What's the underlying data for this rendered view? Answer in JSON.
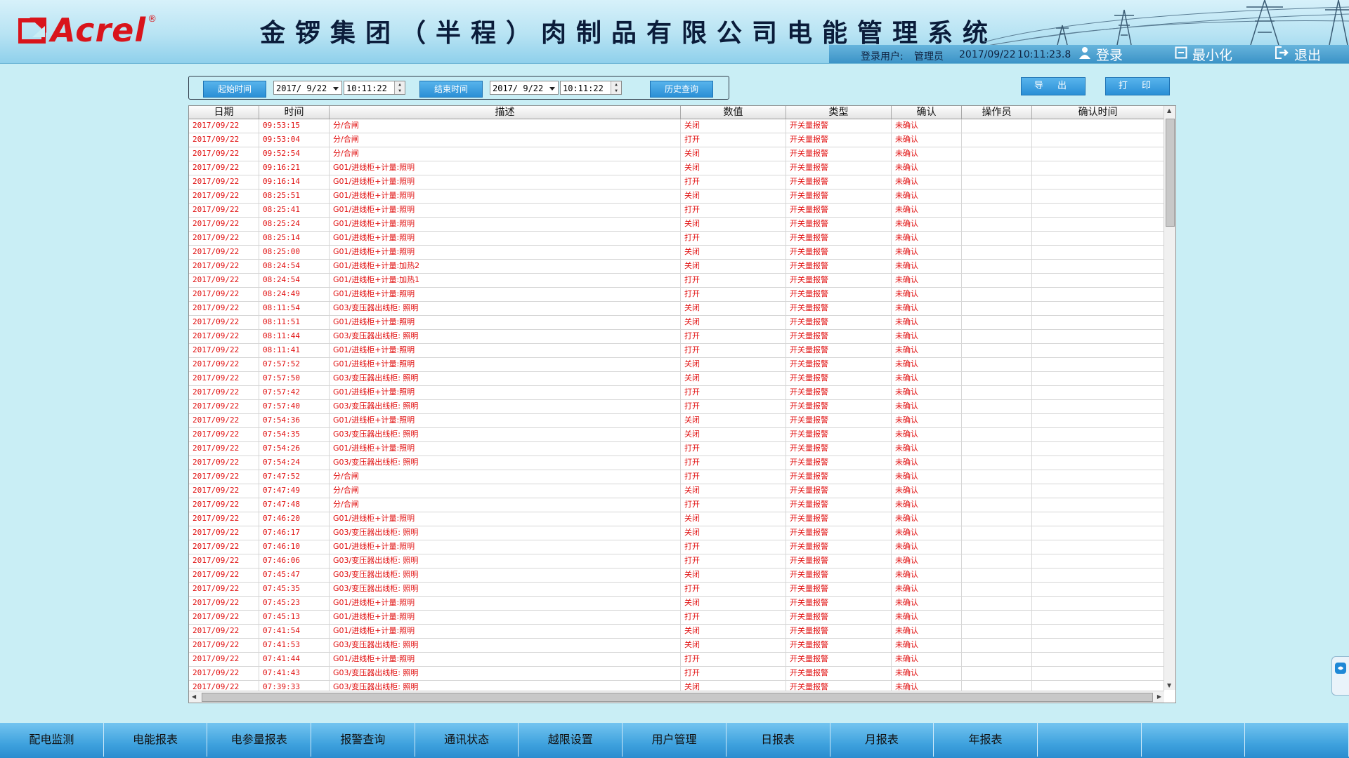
{
  "brand": {
    "name": "Acrel",
    "reg": "®",
    "accent": "#d9141b"
  },
  "title": "金锣集团（半程）肉制品有限公司电能管理系统",
  "header": {
    "user_label": "登录用户:",
    "user_name": "管理员",
    "date": "2017/09/22",
    "time": "10:11:23.8",
    "login": "登录",
    "minimize": "最小化",
    "exit": "退出"
  },
  "query": {
    "start_label": "起始时间",
    "start_date": "2017/ 9/22",
    "start_time": "10:11:22",
    "end_label": "结束时间",
    "end_date": "2017/ 9/22",
    "end_time": "10:11:22",
    "history_label": "历史查询",
    "export_label": "导 出",
    "print_label": "打 印"
  },
  "table": {
    "columns": [
      "日期",
      "时间",
      "描述",
      "数值",
      "类型",
      "确认",
      "操作员",
      "确认时间"
    ],
    "rows": [
      [
        "2017/09/22",
        "09:53:15",
        "分/合闸",
        "关闭",
        "开关量报警",
        "未确认",
        "",
        ""
      ],
      [
        "2017/09/22",
        "09:53:04",
        "分/合闸",
        "打开",
        "开关量报警",
        "未确认",
        "",
        ""
      ],
      [
        "2017/09/22",
        "09:52:54",
        "分/合闸",
        "关闭",
        "开关量报警",
        "未确认",
        "",
        ""
      ],
      [
        "2017/09/22",
        "09:16:21",
        "G01/进线柜+计量:照明",
        "关闭",
        "开关量报警",
        "未确认",
        "",
        ""
      ],
      [
        "2017/09/22",
        "09:16:14",
        "G01/进线柜+计量:照明",
        "打开",
        "开关量报警",
        "未确认",
        "",
        ""
      ],
      [
        "2017/09/22",
        "08:25:51",
        "G01/进线柜+计量:照明",
        "关闭",
        "开关量报警",
        "未确认",
        "",
        ""
      ],
      [
        "2017/09/22",
        "08:25:41",
        "G01/进线柜+计量:照明",
        "打开",
        "开关量报警",
        "未确认",
        "",
        ""
      ],
      [
        "2017/09/22",
        "08:25:24",
        "G01/进线柜+计量:照明",
        "关闭",
        "开关量报警",
        "未确认",
        "",
        ""
      ],
      [
        "2017/09/22",
        "08:25:14",
        "G01/进线柜+计量:照明",
        "打开",
        "开关量报警",
        "未确认",
        "",
        ""
      ],
      [
        "2017/09/22",
        "08:25:00",
        "G01/进线柜+计量:照明",
        "关闭",
        "开关量报警",
        "未确认",
        "",
        ""
      ],
      [
        "2017/09/22",
        "08:24:54",
        "G01/进线柜+计量:加热2",
        "关闭",
        "开关量报警",
        "未确认",
        "",
        ""
      ],
      [
        "2017/09/22",
        "08:24:54",
        "G01/进线柜+计量:加热1",
        "打开",
        "开关量报警",
        "未确认",
        "",
        ""
      ],
      [
        "2017/09/22",
        "08:24:49",
        "G01/进线柜+计量:照明",
        "打开",
        "开关量报警",
        "未确认",
        "",
        ""
      ],
      [
        "2017/09/22",
        "08:11:54",
        "G03/变压器出线柜: 照明",
        "关闭",
        "开关量报警",
        "未确认",
        "",
        ""
      ],
      [
        "2017/09/22",
        "08:11:51",
        "G01/进线柜+计量:照明",
        "关闭",
        "开关量报警",
        "未确认",
        "",
        ""
      ],
      [
        "2017/09/22",
        "08:11:44",
        "G03/变压器出线柜: 照明",
        "打开",
        "开关量报警",
        "未确认",
        "",
        ""
      ],
      [
        "2017/09/22",
        "08:11:41",
        "G01/进线柜+计量:照明",
        "打开",
        "开关量报警",
        "未确认",
        "",
        ""
      ],
      [
        "2017/09/22",
        "07:57:52",
        "G01/进线柜+计量:照明",
        "关闭",
        "开关量报警",
        "未确认",
        "",
        ""
      ],
      [
        "2017/09/22",
        "07:57:50",
        "G03/变压器出线柜: 照明",
        "关闭",
        "开关量报警",
        "未确认",
        "",
        ""
      ],
      [
        "2017/09/22",
        "07:57:42",
        "G01/进线柜+计量:照明",
        "打开",
        "开关量报警",
        "未确认",
        "",
        ""
      ],
      [
        "2017/09/22",
        "07:57:40",
        "G03/变压器出线柜: 照明",
        "打开",
        "开关量报警",
        "未确认",
        "",
        ""
      ],
      [
        "2017/09/22",
        "07:54:36",
        "G01/进线柜+计量:照明",
        "关闭",
        "开关量报警",
        "未确认",
        "",
        ""
      ],
      [
        "2017/09/22",
        "07:54:35",
        "G03/变压器出线柜: 照明",
        "关闭",
        "开关量报警",
        "未确认",
        "",
        ""
      ],
      [
        "2017/09/22",
        "07:54:26",
        "G01/进线柜+计量:照明",
        "打开",
        "开关量报警",
        "未确认",
        "",
        ""
      ],
      [
        "2017/09/22",
        "07:54:24",
        "G03/变压器出线柜: 照明",
        "打开",
        "开关量报警",
        "未确认",
        "",
        ""
      ],
      [
        "2017/09/22",
        "07:47:52",
        "分/合闸",
        "打开",
        "开关量报警",
        "未确认",
        "",
        ""
      ],
      [
        "2017/09/22",
        "07:47:49",
        "分/合闸",
        "关闭",
        "开关量报警",
        "未确认",
        "",
        ""
      ],
      [
        "2017/09/22",
        "07:47:48",
        "分/合闸",
        "打开",
        "开关量报警",
        "未确认",
        "",
        ""
      ],
      [
        "2017/09/22",
        "07:46:20",
        "G01/进线柜+计量:照明",
        "关闭",
        "开关量报警",
        "未确认",
        "",
        ""
      ],
      [
        "2017/09/22",
        "07:46:17",
        "G03/变压器出线柜: 照明",
        "关闭",
        "开关量报警",
        "未确认",
        "",
        ""
      ],
      [
        "2017/09/22",
        "07:46:10",
        "G01/进线柜+计量:照明",
        "打开",
        "开关量报警",
        "未确认",
        "",
        ""
      ],
      [
        "2017/09/22",
        "07:46:06",
        "G03/变压器出线柜: 照明",
        "打开",
        "开关量报警",
        "未确认",
        "",
        ""
      ],
      [
        "2017/09/22",
        "07:45:47",
        "G03/变压器出线柜: 照明",
        "关闭",
        "开关量报警",
        "未确认",
        "",
        ""
      ],
      [
        "2017/09/22",
        "07:45:35",
        "G03/变压器出线柜: 照明",
        "打开",
        "开关量报警",
        "未确认",
        "",
        ""
      ],
      [
        "2017/09/22",
        "07:45:23",
        "G01/进线柜+计量:照明",
        "关闭",
        "开关量报警",
        "未确认",
        "",
        ""
      ],
      [
        "2017/09/22",
        "07:45:13",
        "G01/进线柜+计量:照明",
        "打开",
        "开关量报警",
        "未确认",
        "",
        ""
      ],
      [
        "2017/09/22",
        "07:41:54",
        "G01/进线柜+计量:照明",
        "关闭",
        "开关量报警",
        "未确认",
        "",
        ""
      ],
      [
        "2017/09/22",
        "07:41:53",
        "G03/变压器出线柜: 照明",
        "关闭",
        "开关量报警",
        "未确认",
        "",
        ""
      ],
      [
        "2017/09/22",
        "07:41:44",
        "G01/进线柜+计量:照明",
        "打开",
        "开关量报警",
        "未确认",
        "",
        ""
      ],
      [
        "2017/09/22",
        "07:41:43",
        "G03/变压器出线柜: 照明",
        "打开",
        "开关量报警",
        "未确认",
        "",
        ""
      ],
      [
        "2017/09/22",
        "07:39:33",
        "G03/变压器出线柜: 照明",
        "关闭",
        "开关量报警",
        "未确认",
        "",
        ""
      ]
    ]
  },
  "nav": [
    "配电监测",
    "电能报表",
    "电参量报表",
    "报警查询",
    "通讯状态",
    "越限设置",
    "用户管理",
    "日报表",
    "月报表",
    "年报表",
    "",
    "",
    ""
  ],
  "colors": {
    "alarm_text": "#e10f0f",
    "nav_bg": "#3fa2de",
    "button_bg": "#2a8fd6"
  }
}
